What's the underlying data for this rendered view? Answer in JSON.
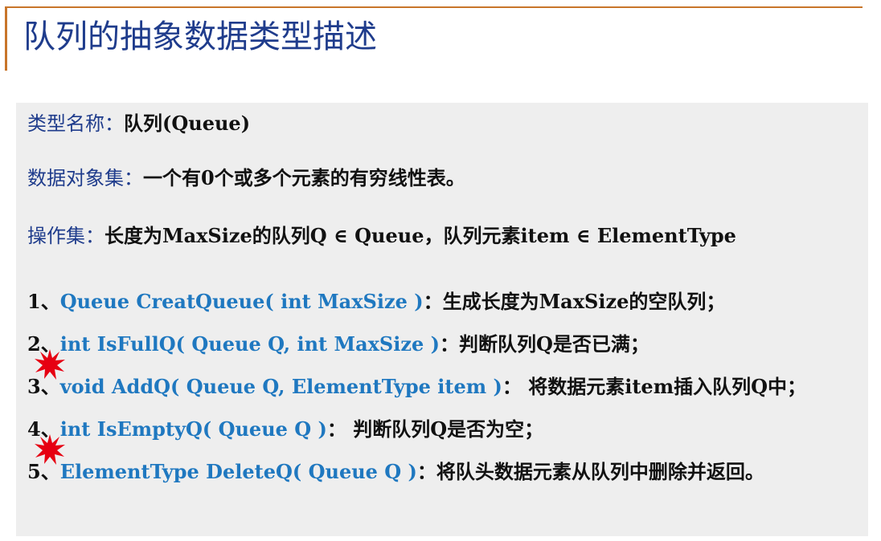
{
  "title": "队列的抽象数据类型描述",
  "type_name": {
    "label": "类型名称：",
    "value": "队列(Queue)"
  },
  "data_objects": {
    "label": "数据对象集：",
    "value": "一个有0个或多个元素的有穷线性表。"
  },
  "operations": {
    "label": "操作集：",
    "value": "长度为MaxSize的队列Q ∈ Queue，队列元素item ∈ ElementType"
  },
  "ops": [
    {
      "num": "1、",
      "signature": "Queue CreatQueue( int MaxSize )",
      "desc": "：生成长度为MaxSize的空队列；"
    },
    {
      "num": "2、",
      "signature": "int IsFullQ( Queue Q, int MaxSize )",
      "desc": "：判断队列Q是否已满；"
    },
    {
      "num": "3、",
      "signature": "void AddQ( Queue Q, ElementType item )",
      "desc": "： 将数据元素item插入队列Q中；"
    },
    {
      "num": "4、",
      "signature": "int IsEmptyQ( Queue Q )",
      "desc": "： 判断队列Q是否为空；"
    },
    {
      "num": "5、",
      "signature": "ElementType DeleteQ( Queue Q )",
      "desc": "：将队头数据元素从队列中删除并返回。"
    }
  ],
  "colors": {
    "accent_line": "#c8752a",
    "title": "#1f3c8c",
    "code": "#1f78c0",
    "star": "#e60012"
  }
}
